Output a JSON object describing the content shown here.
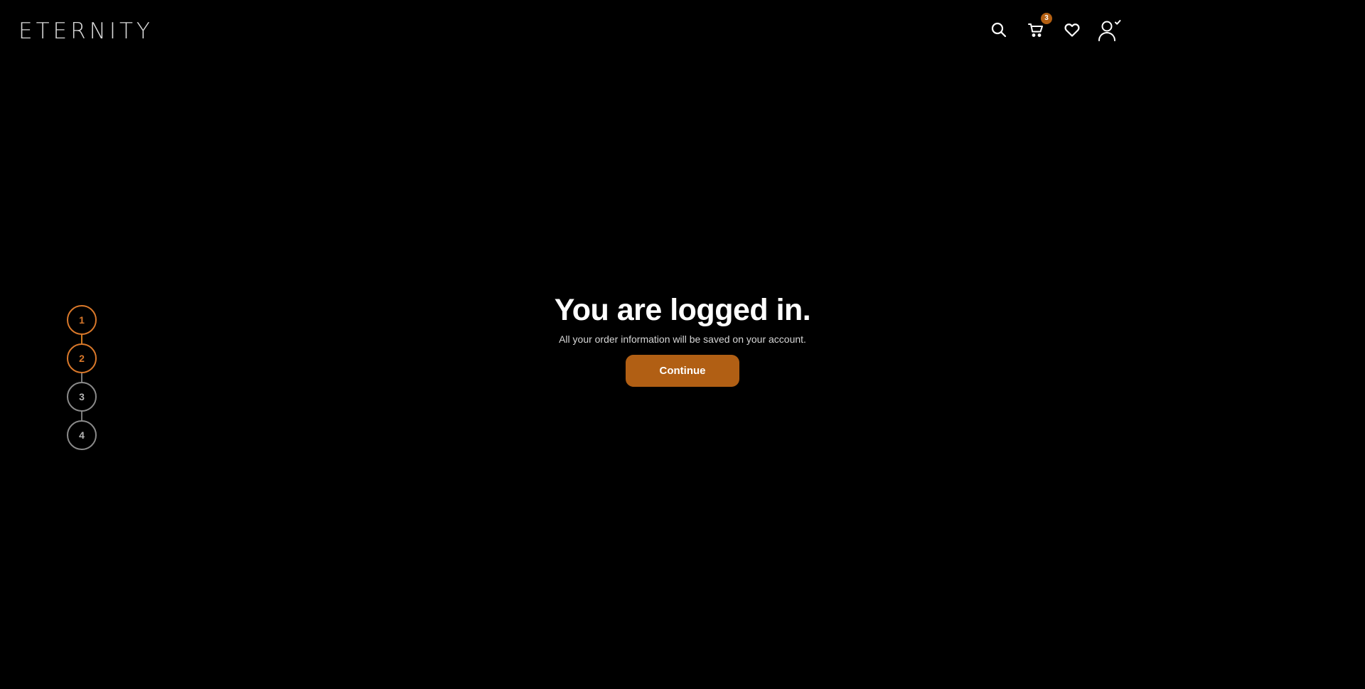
{
  "header": {
    "logo_text": "ETERNITY",
    "cart_count": "3",
    "icons": [
      "search-icon",
      "cart-icon",
      "heart-icon",
      "user-check-icon"
    ]
  },
  "stepper": {
    "steps": [
      {
        "label": "1",
        "state": "active"
      },
      {
        "label": "2",
        "state": "active"
      },
      {
        "label": "3",
        "state": "inactive"
      },
      {
        "label": "4",
        "state": "inactive"
      }
    ]
  },
  "main": {
    "title": "You are logged in.",
    "subtitle": "All your order information will be saved on your account.",
    "continue_label": "Continue"
  },
  "colors": {
    "background": "#000000",
    "accent": "#b15f14",
    "step_active": "#d9782a",
    "step_inactive": "#8a8a8a"
  }
}
